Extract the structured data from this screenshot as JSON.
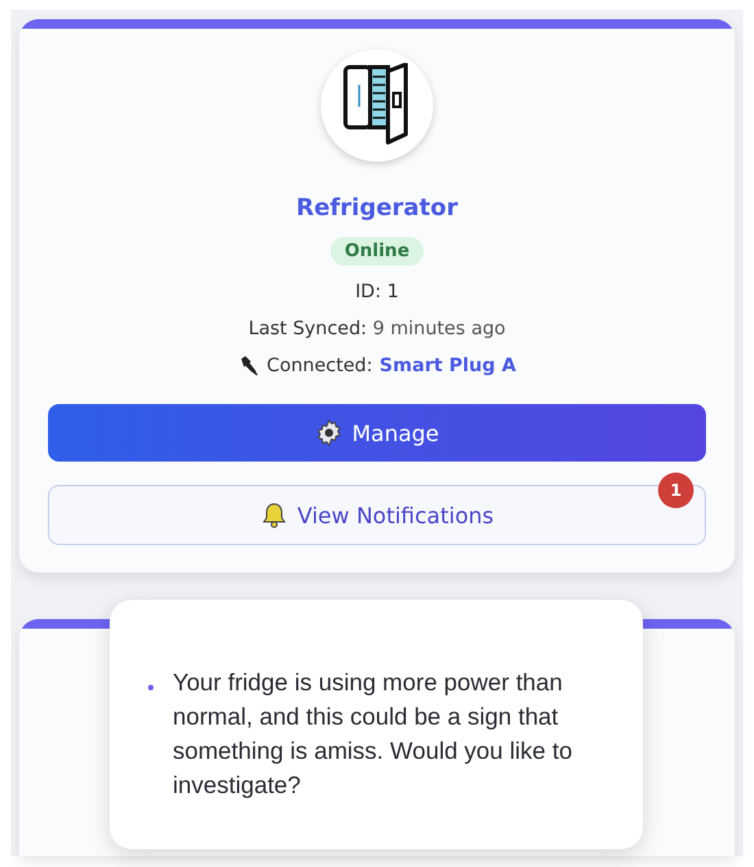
{
  "device": {
    "name": "Refrigerator",
    "status": {
      "label": "Online",
      "kind": "online"
    },
    "id_label": "ID:",
    "id_value": "1",
    "synced_label": "Last Synced:",
    "synced_value": "9 minutes ago",
    "connected_label": "Connected:",
    "connected_value": "Smart Plug A"
  },
  "buttons": [
    {
      "kind": "primary",
      "label": "Manage"
    },
    {
      "kind": "notifications",
      "label": "View Notifications",
      "badge": "1"
    }
  ],
  "notification_popup": {
    "items": [
      "Your fridge is using more power than normal, and this could be a sign that something is amiss. Would you like to investigate?"
    ]
  }
}
